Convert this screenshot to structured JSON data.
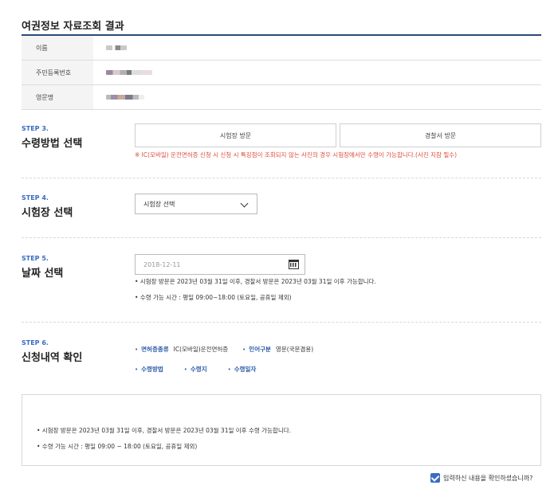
{
  "page_title": "여권정보 자료조회 결과",
  "info": [
    {
      "label": "이름"
    },
    {
      "label": "주민등록번호"
    },
    {
      "label": "영문명"
    }
  ],
  "step3": {
    "num": "STEP 3.",
    "title": "수령방법 선택",
    "options": [
      "시험장 방문",
      "경찰서 방문"
    ],
    "warning": "※ IC(모바일) 운전면허증 신청 시 신청 시 특징점이 조회되지 않는 사진의 경우 시험장에서만 수령이 가능합니다.(사진 지참 필수)"
  },
  "step4": {
    "num": "STEP 4.",
    "title": "시험장 선택",
    "select_value": "시험장 선택"
  },
  "step5": {
    "num": "STEP 5.",
    "title": "날짜 선택",
    "date_placeholder": "2018-12-11",
    "notes": [
      "• 시험장 방문은 2023년 03월 31일 이후, 경찰서 방문은 2023년 03월 31일 이후 가능합니다.",
      "• 수령 가능 시간 : 평일 09:00~18:00 (토요일, 공휴일 제외)"
    ]
  },
  "step6": {
    "num": "STEP 6.",
    "title": "신청내역 확인",
    "license_type_label": "면허증종류",
    "license_type_value": "IC(모바일)운전면허증",
    "print_type_label": "인어구분",
    "print_type_value": "영문(국문겸용)",
    "method_label": "수령방법",
    "place_label": "수령지",
    "date_label": "수령일자"
  },
  "notice": [
    "• 시험장 방문은 2023년 03월 31일 이후, 경찰서 방문은 2023년 03월 31일 이후 수령 가능합니다.",
    "• 수령 가능 시간 : 평일 09:00 ~ 18:00 (토요일, 공휴일 제외)"
  ],
  "confirm_label": "입력하신 내용을 확인하셨습니까?",
  "colors": {
    "accent": "#3a6cc4",
    "warning": "#e04a3a",
    "title_line": "#2c4a78"
  }
}
